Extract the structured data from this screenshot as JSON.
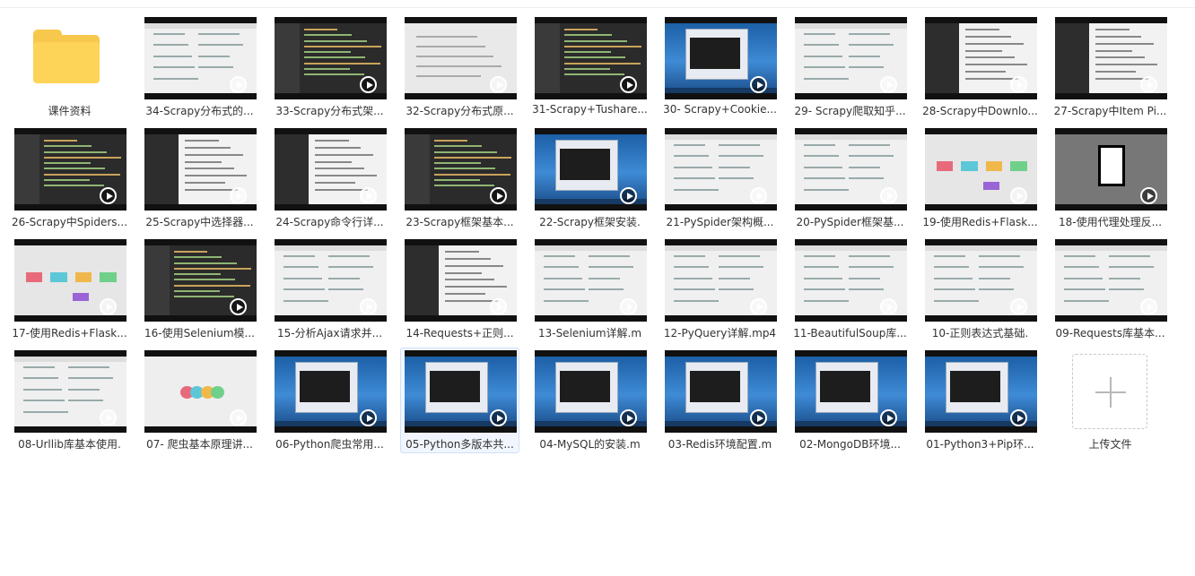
{
  "folder": {
    "label": "课件资料"
  },
  "upload": {
    "label": "上传文件"
  },
  "videos": [
    {
      "label": "34-Scrapy分布式的...",
      "style": "light"
    },
    {
      "label": "33-Scrapy分布式架...",
      "style": "ide"
    },
    {
      "label": "32-Scrapy分布式原...",
      "style": "doc"
    },
    {
      "label": "31-Scrapy+Tushare...",
      "style": "ide"
    },
    {
      "label": "30- Scrapy+Cookie...",
      "style": "desktop"
    },
    {
      "label": "29- Scrapy爬取知乎...",
      "style": "light"
    },
    {
      "label": "28-Scrapy中Downlo...",
      "style": "mixed"
    },
    {
      "label": "27-Scrapy中Item Pi...",
      "style": "mixed"
    },
    {
      "label": "26-Scrapy中Spiders...",
      "style": "ide"
    },
    {
      "label": "25-Scrapy中选择器...",
      "style": "mixed"
    },
    {
      "label": "24-Scrapy命令行详...",
      "style": "mixed"
    },
    {
      "label": "23-Scrapy框架基本...",
      "style": "ide"
    },
    {
      "label": "22-Scrapy框架安装.",
      "style": "desktop"
    },
    {
      "label": "21-PySpider架构概...",
      "style": "light"
    },
    {
      "label": "20-PySpider框架基...",
      "style": "light"
    },
    {
      "label": "19-使用Redis+Flask...",
      "style": "boxes"
    },
    {
      "label": "18-使用代理处理反...",
      "style": "qr"
    },
    {
      "label": "17-使用Redis+Flask...",
      "style": "boxes"
    },
    {
      "label": "16-使用Selenium模...",
      "style": "ide"
    },
    {
      "label": "15-分析Ajax请求并...",
      "style": "light"
    },
    {
      "label": "14-Requests+正则...",
      "style": "mixed"
    },
    {
      "label": "13-Selenium详解.m",
      "style": "light"
    },
    {
      "label": "12-PyQuery详解.mp4",
      "style": "light"
    },
    {
      "label": "11-BeautifulSoup库...",
      "style": "light"
    },
    {
      "label": "10-正则表达式基础.",
      "style": "light"
    },
    {
      "label": "09-Requests库基本...",
      "style": "light"
    },
    {
      "label": "08-Urllib库基本使用.",
      "style": "light"
    },
    {
      "label": "07- 爬虫基本原理讲...",
      "style": "circles"
    },
    {
      "label": "06-Python爬虫常用...",
      "style": "desktop"
    },
    {
      "label": "05-Python多版本共...",
      "style": "desktop",
      "selected": true
    },
    {
      "label": "04-MySQL的安装.m",
      "style": "desktop"
    },
    {
      "label": "03-Redis环境配置.m",
      "style": "desktop"
    },
    {
      "label": "02-MongoDB环境...",
      "style": "desktop"
    },
    {
      "label": "01-Python3+Pip环...",
      "style": "desktop"
    }
  ]
}
